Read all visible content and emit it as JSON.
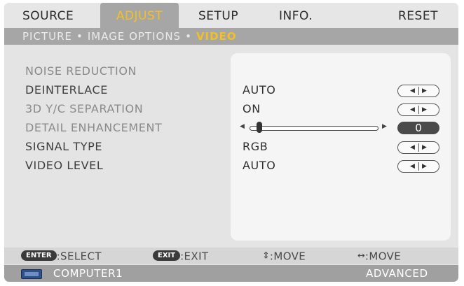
{
  "tabs": [
    {
      "label": "SOURCE",
      "active": false
    },
    {
      "label": "ADJUST",
      "active": true
    },
    {
      "label": "SETUP",
      "active": false
    },
    {
      "label": "INFO.",
      "active": false
    },
    {
      "label": "RESET",
      "active": false
    }
  ],
  "breadcrumb": {
    "items": [
      "PICTURE",
      "IMAGE OPTIONS",
      "VIDEO"
    ],
    "separator": "•"
  },
  "settings": [
    {
      "label": "NOISE REDUCTION",
      "value": "",
      "enabled": false,
      "control": "none"
    },
    {
      "label": "DEINTERLACE",
      "value": "AUTO",
      "enabled": true,
      "control": "arrows"
    },
    {
      "label": "3D Y/C SEPARATION",
      "value": "ON",
      "enabled": false,
      "control": "arrows"
    },
    {
      "label": "DETAIL ENHANCEMENT",
      "value": "0",
      "enabled": false,
      "control": "slider",
      "slider_level": 0.05
    },
    {
      "label": "SIGNAL TYPE",
      "value": "RGB",
      "enabled": true,
      "control": "arrows"
    },
    {
      "label": "VIDEO LEVEL",
      "value": "AUTO",
      "enabled": true,
      "control": "arrows"
    }
  ],
  "help": {
    "enter_key": "ENTER",
    "enter_text": ":SELECT",
    "exit_key": "EXIT",
    "exit_text": ":EXIT",
    "updown_icon": "⇕",
    "updown_text": ":MOVE",
    "leftright_icon": "↔",
    "leftright_text": ":MOVE"
  },
  "status": {
    "source": "COMPUTER1",
    "mode": "ADVANCED"
  },
  "colors": {
    "accent": "#f2c022",
    "tab_active_bg": "#a6a6a6",
    "status_bg": "#a0a0a0"
  }
}
